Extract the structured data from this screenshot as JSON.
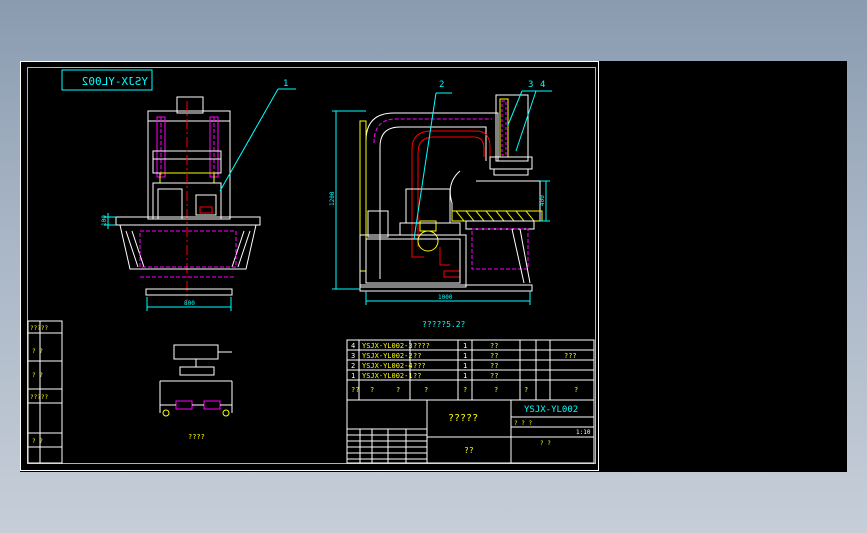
{
  "title_mirrored": "YSJX-YL002",
  "leaders": [
    "1",
    "2",
    "3",
    "4"
  ],
  "dims": {
    "front_width": "800",
    "front_small": "100",
    "side_height": "1200",
    "side_width": "1000",
    "side_throat": "400"
  },
  "tech_note": "?????5.2?",
  "hydraulic_caption": "????",
  "left_strip": [
    "?????",
    "?  ?",
    "?  ?",
    "?????",
    "?  ?"
  ],
  "parts": [
    {
      "no": "4",
      "code": "YSJX-YL002-3",
      "name": "????",
      "qty": "1",
      "mat": "??",
      "note": "???"
    },
    {
      "no": "3",
      "code": "YSJX-YL002-2",
      "name": "??",
      "qty": "1",
      "mat": "??",
      "note": ""
    },
    {
      "no": "2",
      "code": "YSJX-YL002-4",
      "name": "???",
      "qty": "1",
      "mat": "??",
      "note": ""
    },
    {
      "no": "1",
      "code": "YSJX-YL002-1",
      "name": "??",
      "qty": "1",
      "mat": "??",
      "note": ""
    }
  ],
  "parts_header": [
    "??",
    "?",
    "?",
    "?",
    "?",
    "?",
    "?",
    "?"
  ],
  "title_block": {
    "name": "?????",
    "drawing_no": "YSJX-YL002",
    "material": "??",
    "scale": "1:10",
    "q1": "? ? ?",
    "q2": "? ?"
  },
  "colors": {
    "frame": "#00ffff",
    "white": "#ffffff",
    "yellow": "#ffff00",
    "magenta": "#ff00ff",
    "red": "#ff0000",
    "green": "#00ff00"
  }
}
